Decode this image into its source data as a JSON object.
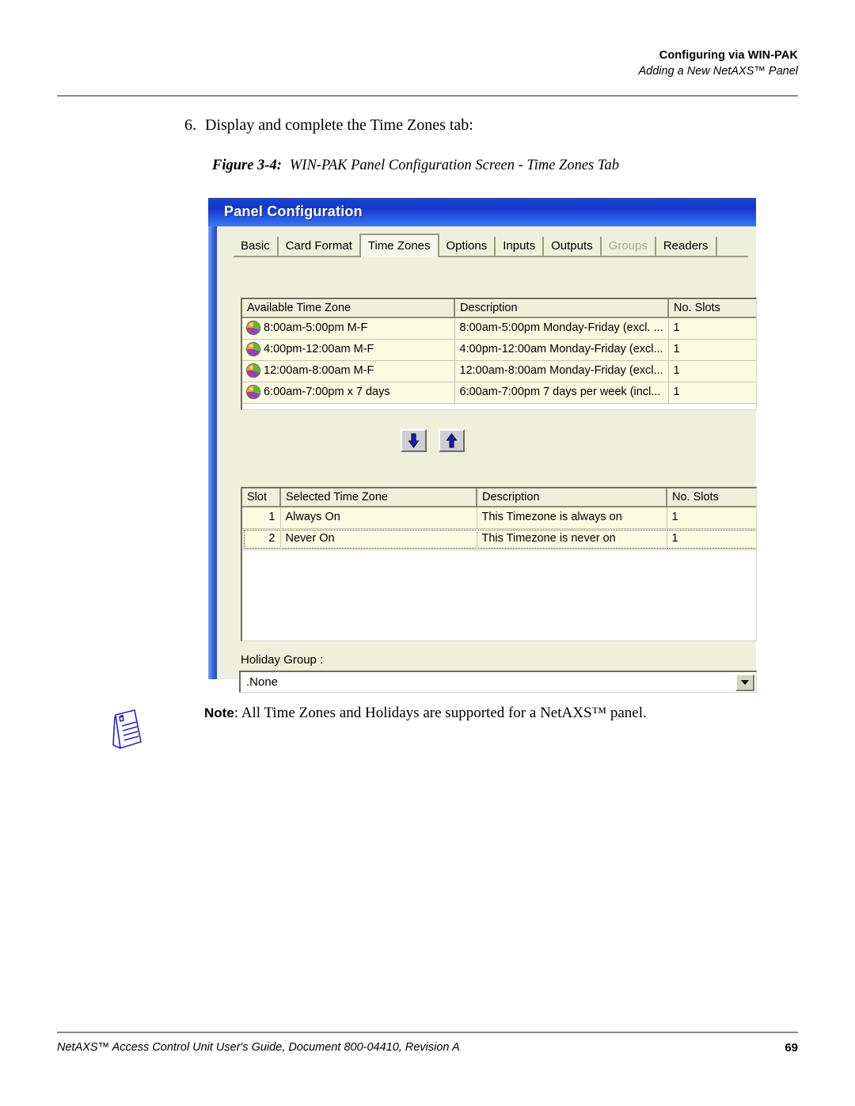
{
  "header": {
    "line1": "Configuring via WIN-PAK",
    "line2": "Adding a New NetAXS™ Panel"
  },
  "step": {
    "number": "6.",
    "text": "Display and complete the Time Zones tab:"
  },
  "figure": {
    "label": "Figure 3-4:",
    "caption": "WIN-PAK Panel Configuration Screen - Time Zones Tab"
  },
  "dialog": {
    "title": "Panel Configuration",
    "title_bar_color": "#1536c9",
    "body_color": "#eef0dc",
    "tabs": [
      {
        "label": "Basic",
        "state": "normal"
      },
      {
        "label": "Card Format",
        "state": "normal"
      },
      {
        "label": "Time Zones",
        "state": "active"
      },
      {
        "label": "Options",
        "state": "normal"
      },
      {
        "label": "Inputs",
        "state": "normal"
      },
      {
        "label": "Outputs",
        "state": "normal"
      },
      {
        "label": "Groups",
        "state": "disabled"
      },
      {
        "label": "Readers",
        "state": "normal"
      }
    ],
    "available": {
      "columns": [
        "Available Time Zone",
        "Description",
        "No. Slots"
      ],
      "rows": [
        {
          "icon": "timezone-clock-icon",
          "name": "8:00am-5:00pm M-F",
          "description": "8:00am-5:00pm Monday-Friday (excl. ...",
          "slots": "1"
        },
        {
          "icon": "timezone-clock-icon",
          "name": "4:00pm-12:00am M-F",
          "description": "4:00pm-12:00am Monday-Friday (excl...",
          "slots": "1"
        },
        {
          "icon": "timezone-clock-icon",
          "name": "12:00am-8:00am M-F",
          "description": "12:00am-8:00am Monday-Friday (excl...",
          "slots": "1"
        },
        {
          "icon": "timezone-clock-icon",
          "name": "6:00am-7:00pm x 7 days",
          "description": "6:00am-7:00pm 7 days per week (incl...",
          "slots": "1"
        }
      ]
    },
    "transfer_buttons": [
      {
        "name": "add-timezone-button",
        "icon": "arrow-down-icon"
      },
      {
        "name": "remove-timezone-button",
        "icon": "arrow-up-icon"
      }
    ],
    "selected": {
      "columns": [
        "Slot",
        "Selected Time Zone",
        "Description",
        "No. Slots"
      ],
      "rows": [
        {
          "slot": "1",
          "name": "Always On",
          "description": "This Timezone is always on",
          "slots": "1",
          "focused": false
        },
        {
          "slot": "2",
          "name": "Never On",
          "description": "This Timezone is never on",
          "slots": "1",
          "focused": true
        }
      ]
    },
    "holiday_group": {
      "label": "Holiday Group :",
      "value": ".None",
      "arrow_icon": "chevron-down-icon"
    }
  },
  "note": {
    "icon": "note-paper-icon",
    "label": "Note",
    "separator": ":",
    "text": " All Time Zones and Holidays are supported for a NetAXS™ panel."
  },
  "footer": {
    "text": "NetAXS™ Access Control Unit User's Guide, Document 800-04410, Revision A",
    "page": "69"
  }
}
